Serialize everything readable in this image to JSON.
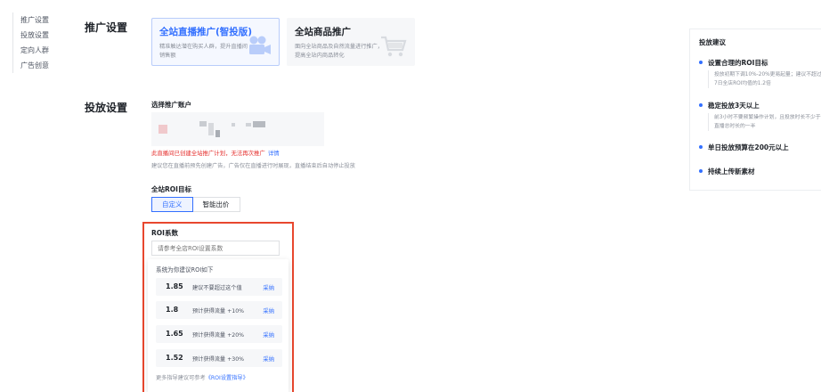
{
  "nav": {
    "items": [
      "推广设置",
      "投放设置",
      "定向人群",
      "广告创意"
    ]
  },
  "sections": {
    "promo_title": "推广设置",
    "delivery_title": "投放设置"
  },
  "cards": [
    {
      "title": "全站直播推广(智投版)",
      "desc": "精准触达潜在购买人群，提升直播间销售额",
      "icon": "camera-icon",
      "selected": true
    },
    {
      "title": "全站商品推广",
      "desc": "面向全站商品及自然流量进行推广，提高全站内商品转化",
      "icon": "cart-icon",
      "selected": false
    }
  ],
  "account": {
    "label": "选择推广账户",
    "warning": "此直播间已创建全站推广计划，无法再次推广",
    "warning_link": "详情",
    "hint": "建议您在直播前预先创建广告，广告仅在直播进行时展现，直播结束后自动停止投放"
  },
  "roi_target": {
    "label": "全站ROI目标",
    "options": [
      "自定义",
      "智能出价"
    ],
    "selected": "自定义"
  },
  "roi_coef": {
    "label": "ROI系数",
    "placeholder": "请参考全店ROI设置系数",
    "dropdown_title": "系统为你建议ROI如下",
    "suggestions": [
      {
        "value": "1.85",
        "text": "建议不要超过这个值",
        "action": "采纳"
      },
      {
        "value": "1.8",
        "text": "预计获得流量 +10%",
        "action": "采纳"
      },
      {
        "value": "1.65",
        "text": "预计获得流量 +20%",
        "action": "采纳"
      },
      {
        "value": "1.52",
        "text": "预计获得流量 +30%",
        "action": "采纳"
      }
    ],
    "footer_text": "更多指导建议可参考",
    "footer_link": "《ROI设置指导》"
  },
  "tips": {
    "title": "投放建议",
    "items": [
      {
        "head": "设置合理的ROI目标",
        "body": "投放初期下调10%-20%更易起量；建议不超过7日全店ROI均值的1.2倍"
      },
      {
        "head": "稳定投放3天以上",
        "body": "前3小时不要频繁操作计划，且投放时长不少于直播总时长的一半"
      },
      {
        "head": "单日投放预算在200元以上",
        "body": ""
      },
      {
        "head": "持续上传新素材",
        "body": ""
      }
    ]
  },
  "colors": {
    "accent": "#3370ff",
    "warning": "#e5312f",
    "highlight": "#e8472e"
  }
}
